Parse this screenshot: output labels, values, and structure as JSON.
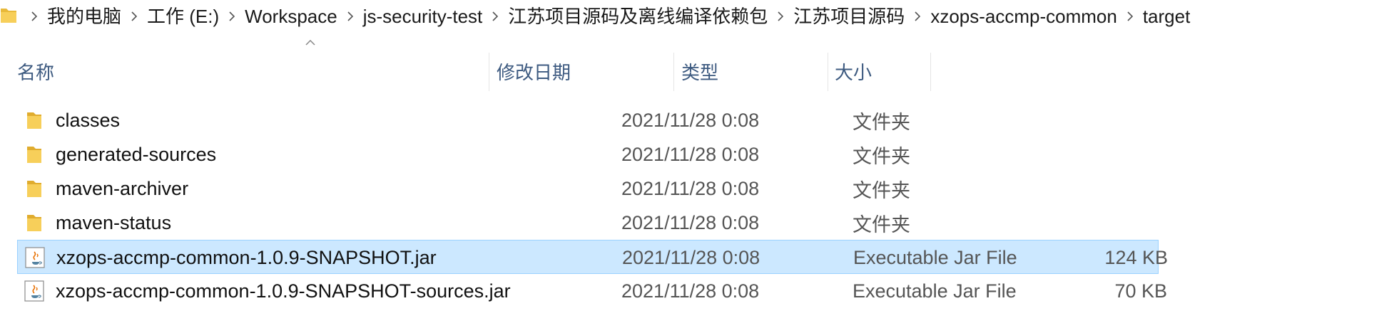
{
  "breadcrumb": {
    "items": [
      "我的电脑",
      "工作 (E:)",
      "Workspace",
      "js-security-test",
      "江苏项目源码及离线编译依赖包",
      "江苏项目源码",
      "xzops-accmp-common",
      "target"
    ]
  },
  "columns": {
    "name": "名称",
    "modified": "修改日期",
    "type": "类型",
    "size": "大小"
  },
  "files": [
    {
      "name": "classes",
      "modified": "2021/11/28 0:08",
      "type": "文件夹",
      "size": "",
      "icon": "folder-icon",
      "selected": false
    },
    {
      "name": "generated-sources",
      "modified": "2021/11/28 0:08",
      "type": "文件夹",
      "size": "",
      "icon": "folder-icon",
      "selected": false
    },
    {
      "name": "maven-archiver",
      "modified": "2021/11/28 0:08",
      "type": "文件夹",
      "size": "",
      "icon": "folder-icon",
      "selected": false
    },
    {
      "name": "maven-status",
      "modified": "2021/11/28 0:08",
      "type": "文件夹",
      "size": "",
      "icon": "folder-icon",
      "selected": false
    },
    {
      "name": "xzops-accmp-common-1.0.9-SNAPSHOT.jar",
      "modified": "2021/11/28 0:08",
      "type": "Executable Jar File",
      "size": "124 KB",
      "icon": "java-jar-icon",
      "selected": true
    },
    {
      "name": "xzops-accmp-common-1.0.9-SNAPSHOT-sources.jar",
      "modified": "2021/11/28 0:08",
      "type": "Executable Jar File",
      "size": "70 KB",
      "icon": "java-jar-icon",
      "selected": false
    }
  ],
  "colors": {
    "selection_bg": "#cce8ff",
    "selection_border": "#99d1ff",
    "header_text": "#3d5a80",
    "folder": "#f5c542"
  }
}
